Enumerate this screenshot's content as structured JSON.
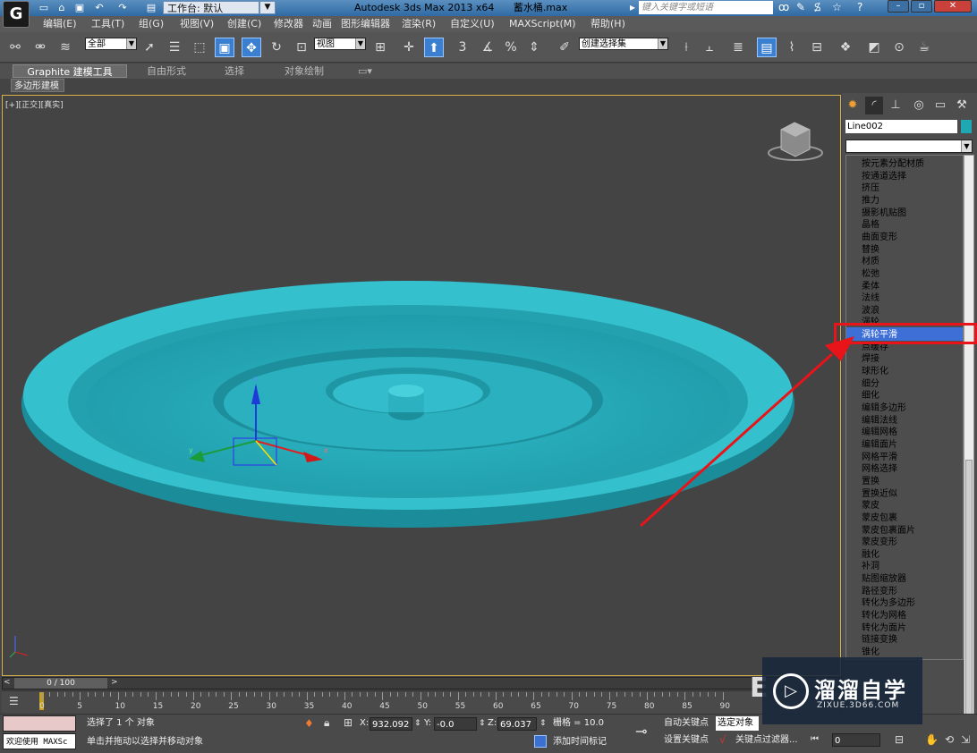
{
  "window": {
    "workspace_label": "工作台: 默认",
    "title_parts": [
      "Autodesk 3ds Max  2013 x64",
      "蓄水桶.max"
    ],
    "search_placeholder": "键入关键字或短语"
  },
  "menubar": [
    "编辑(E)",
    "工具(T)",
    "组(G)",
    "视图(V)",
    "创建(C)",
    "修改器",
    "动画",
    "图形编辑器",
    "渲染(R)",
    "自定义(U)",
    "MAXScript(M)",
    "帮助(H)"
  ],
  "toolbar": {
    "selection_filter": "全部",
    "ref_coord": "视图",
    "snap_labels": [
      "3",
      "%"
    ],
    "named_selection": "创建选择集"
  },
  "ribbon": {
    "tabs": [
      "Graphite 建模工具",
      "自由形式",
      "选择",
      "对象绘制"
    ],
    "subtab": "多边形建模"
  },
  "viewport": {
    "label": "[+][正交][真实]"
  },
  "command_panel": {
    "object_name": "Line002",
    "object_color": "#20a7b4",
    "modifier_list": [
      "按元素分配材质",
      "按通道选择",
      "挤压",
      "推力",
      "摄影机贴图",
      "晶格",
      "曲面变形",
      "替换",
      "材质",
      "松弛",
      "柔体",
      "法线",
      "波浪",
      "涡轮",
      "涡轮平滑",
      "点缓存",
      "焊接",
      "球形化",
      "细分",
      "细化",
      "编辑多边形",
      "编辑法线",
      "编辑网格",
      "编辑面片",
      "网格平滑",
      "网格选择",
      "置换",
      "置换近似",
      "蒙皮",
      "蒙皮包裹",
      "蒙皮包裹面片",
      "蒙皮变形",
      "融化",
      "补洞",
      "贴图缩放器",
      "路径变形",
      "转化为多边形",
      "转化为网格",
      "转化为面片",
      "链接变换",
      "锥化"
    ],
    "highlighted_index": 14
  },
  "timeline": {
    "slider_label": "0 / 100",
    "tick_labels": [
      "0",
      "5",
      "10",
      "15",
      "20",
      "25",
      "30",
      "35",
      "40",
      "45",
      "50",
      "55",
      "60",
      "65",
      "70",
      "75",
      "80",
      "85",
      "90"
    ]
  },
  "status": {
    "maxscript_label": "欢迎使用 MAXSc",
    "selected": "选择了 1 个 对象",
    "prompt": "单击并拖动以选择并移动对象",
    "x_label": "X:",
    "x": "932.092",
    "y_label": "Y:",
    "y": "-0.0",
    "z_label": "Z:",
    "z": "69.037",
    "grid": "栅格 = 10.0",
    "add_time_tag": "添加时间标记",
    "auto_key": "自动关键点",
    "selected_object": "选定对象",
    "set_key": "设置关键点",
    "key_filters": "关键点过滤器...",
    "frame": "0"
  },
  "watermark": {
    "brand": "溜溜自学",
    "url": "ZIXUE.3D66.COM"
  }
}
